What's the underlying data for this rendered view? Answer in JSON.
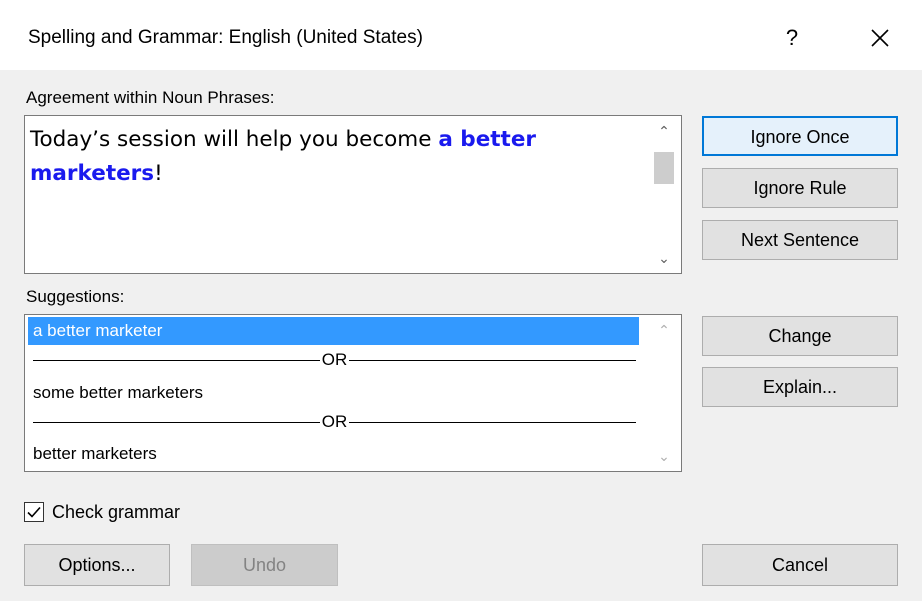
{
  "window": {
    "title": "Spelling and Grammar: English (United States)",
    "help_label": "?",
    "close_label": "×"
  },
  "sentence_section": {
    "label": "Agreement within Noun Phrases:",
    "text_before": "Today’s session will help you become ",
    "error_text": "a better marketers",
    "text_after": "!",
    "error_color": "#1a1aee"
  },
  "suggestions_section": {
    "label": "Suggestions:",
    "items": [
      "a better marketer",
      "OR",
      "some better marketers",
      "OR",
      "better marketers"
    ],
    "selected_index": 0
  },
  "buttons": {
    "ignore_once": "Ignore Once",
    "ignore_rule": "Ignore Rule",
    "next_sentence": "Next Sentence",
    "change": "Change",
    "explain": "Explain...",
    "options": "Options...",
    "undo": "Undo",
    "cancel": "Cancel"
  },
  "check_grammar": {
    "label": "Check grammar",
    "checked": true
  },
  "colors": {
    "selection": "#3399ff",
    "default_button_border": "#0078d7",
    "background": "#f0f0f0"
  },
  "icons": {
    "scroll_up": "chevron-up-icon",
    "scroll_down": "chevron-down-icon",
    "close": "close-icon",
    "checkbox": "checkmark-icon"
  }
}
